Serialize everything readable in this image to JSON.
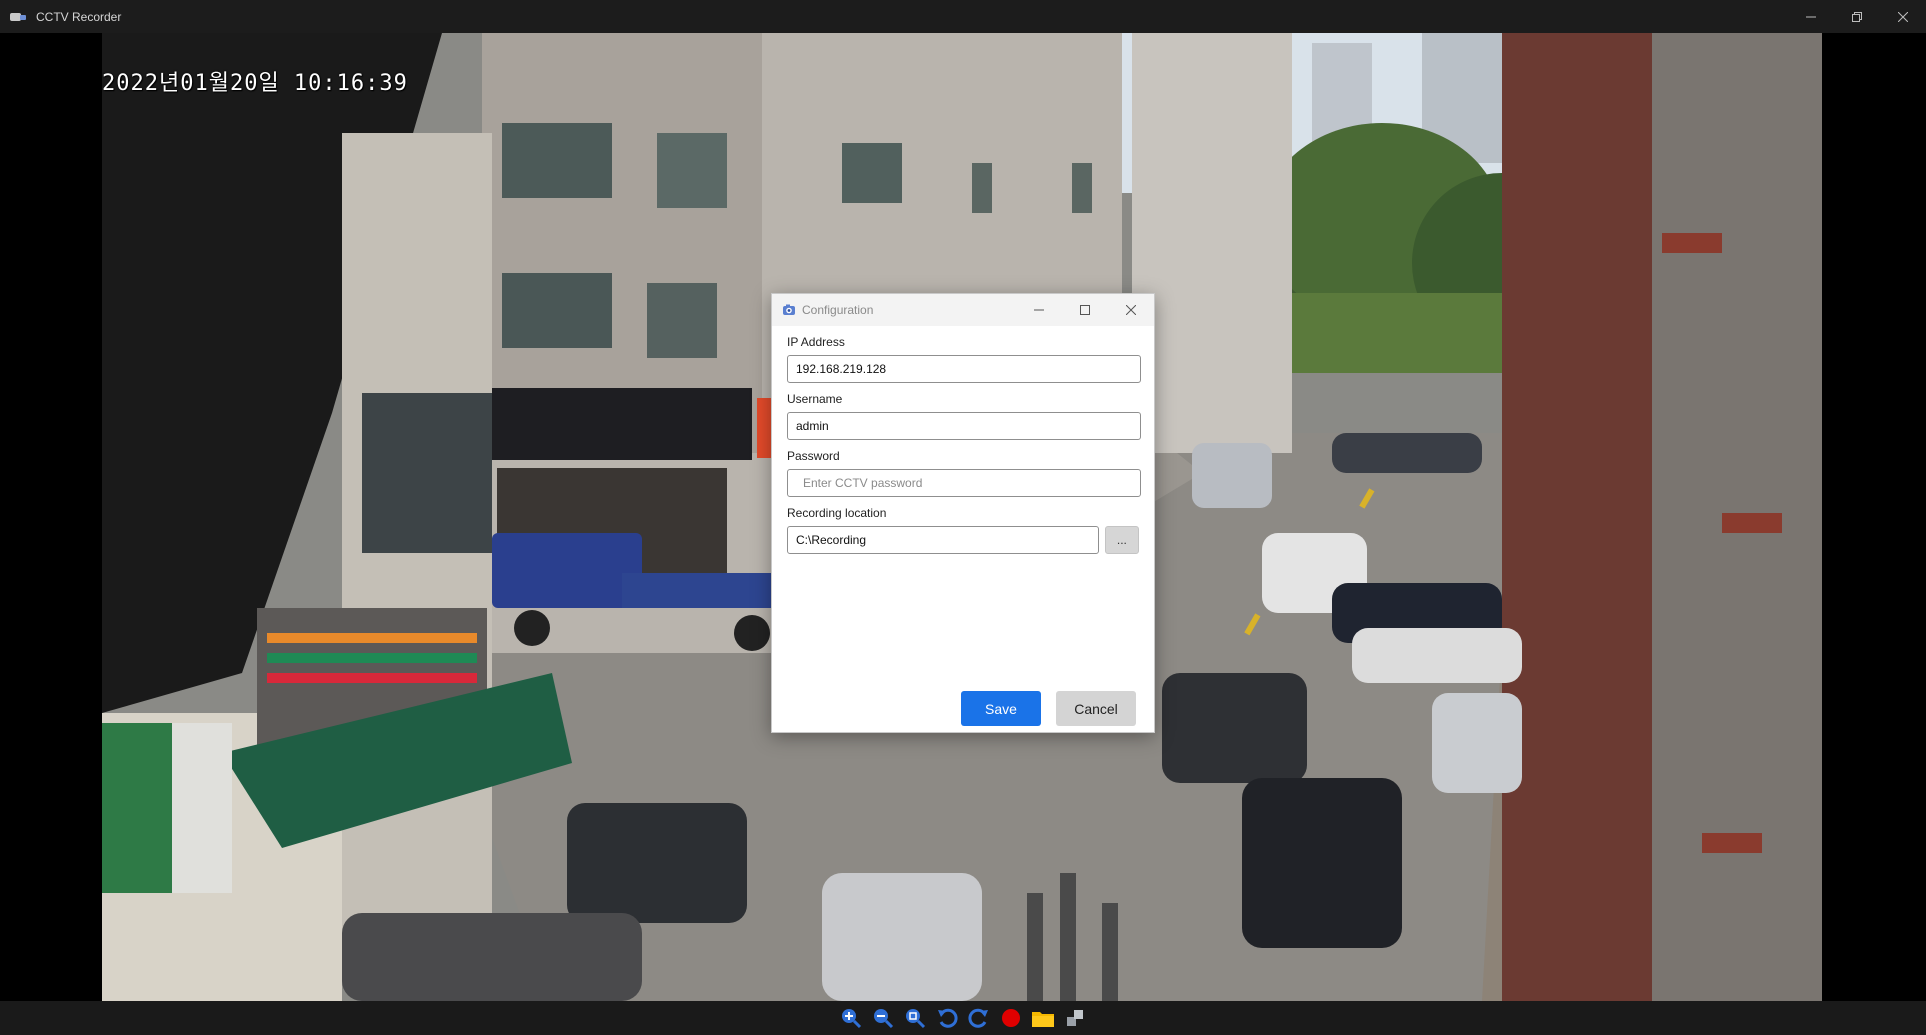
{
  "window": {
    "title": "CCTV Recorder"
  },
  "video": {
    "timestamp": "2022년01월20일 10:16:39"
  },
  "dialog": {
    "title": "Configuration",
    "ip_label": "IP Address",
    "ip_value": "192.168.219.128",
    "username_label": "Username",
    "username_value": "admin",
    "password_label": "Password",
    "password_placeholder": "Enter CCTV password",
    "recording_label": "Recording location",
    "recording_value": "C:\\Recording",
    "browse_label": "...",
    "save_label": "Save",
    "cancel_label": "Cancel"
  },
  "toolbar": {
    "icons": [
      "zoom-in-icon",
      "zoom-out-icon",
      "zoom-fit-icon",
      "rotate-left-icon",
      "rotate-right-icon",
      "record-icon",
      "folder-icon",
      "fullscreen-icon"
    ]
  },
  "colors": {
    "accent": "#1a73e8",
    "record": "#e00000",
    "folder": "#f5b800",
    "toolbar_icon": "#2f6fd6"
  }
}
